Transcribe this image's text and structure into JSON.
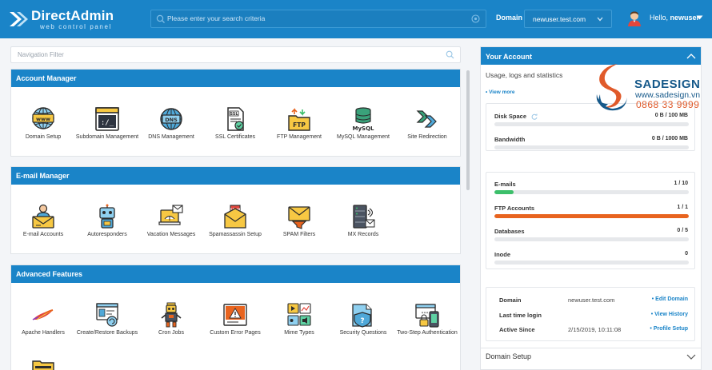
{
  "header": {
    "app_name": "DirectAdmin",
    "app_tagline": "web control panel",
    "search_placeholder": "Please enter your search criteria",
    "domain_label": "Domain",
    "domain_value": "newuser.test.com",
    "greeting": "Hello,",
    "username": "newuser"
  },
  "nav_filter": {
    "placeholder": "Navigation Filter"
  },
  "account_manager": {
    "title": "Account Manager",
    "items": [
      {
        "label": "Domain Setup"
      },
      {
        "label": "Subdomain Management"
      },
      {
        "label": "DNS Management"
      },
      {
        "label": "SSL Certificates"
      },
      {
        "label": "FTP Management"
      },
      {
        "label": "MySQL Management"
      },
      {
        "label": "Site Redirection"
      }
    ]
  },
  "email_manager": {
    "title": "E-mail Manager",
    "items": [
      {
        "label": "E-mail Accounts"
      },
      {
        "label": "Autoresponders"
      },
      {
        "label": "Vacation Messages"
      },
      {
        "label": "Spamassassin Setup"
      },
      {
        "label": "SPAM Filters"
      },
      {
        "label": "MX Records"
      }
    ]
  },
  "advanced_features": {
    "title": "Advanced Features",
    "items": [
      {
        "label": "Apache Handlers"
      },
      {
        "label": "Create/Restore Backups"
      },
      {
        "label": "Cron Jobs"
      },
      {
        "label": "Custom Error Pages"
      },
      {
        "label": "Mime Types"
      },
      {
        "label": "Security Questions"
      },
      {
        "label": "Two-Step Authentication"
      }
    ]
  },
  "your_account": {
    "title": "Your Account",
    "subtitle": "Usage, logs and statistics",
    "view_more": "• View more",
    "disk": {
      "label": "Disk Space",
      "value": "0 B / 100 MB",
      "fraction": 0
    },
    "bandwidth": {
      "label": "Bandwidth",
      "value": "0 B / 1000 MB",
      "fraction": 0
    },
    "emails": {
      "label": "E-mails",
      "value": "1 / 10",
      "fraction": 0.1
    },
    "ftp": {
      "label": "FTP Accounts",
      "value": "1 / 1",
      "fraction": 1
    },
    "databases": {
      "label": "Databases",
      "value": "0 / 5",
      "fraction": 0
    },
    "inode": {
      "label": "Inode",
      "value": "0",
      "fraction": 0
    },
    "info": {
      "domain_label": "Domain",
      "domain_value": "newuser.test.com",
      "edit_domain": "• Edit Domain",
      "login_label": "Last time login",
      "view_history": "• View History",
      "active_label": "Active Since",
      "active_value": "2/15/2019, 10:11:08",
      "profile_setup": "• Profile Setup"
    },
    "domain_setup": "Domain Setup"
  },
  "watermark": {
    "name": "SADESIGN",
    "url": "www.sadesign.vn",
    "phone": "0868 33 9999"
  },
  "colors": {
    "brand_blue": "#1a84c8",
    "email_bar": "#3cbf6a",
    "ftp_bar": "#e8641f"
  }
}
